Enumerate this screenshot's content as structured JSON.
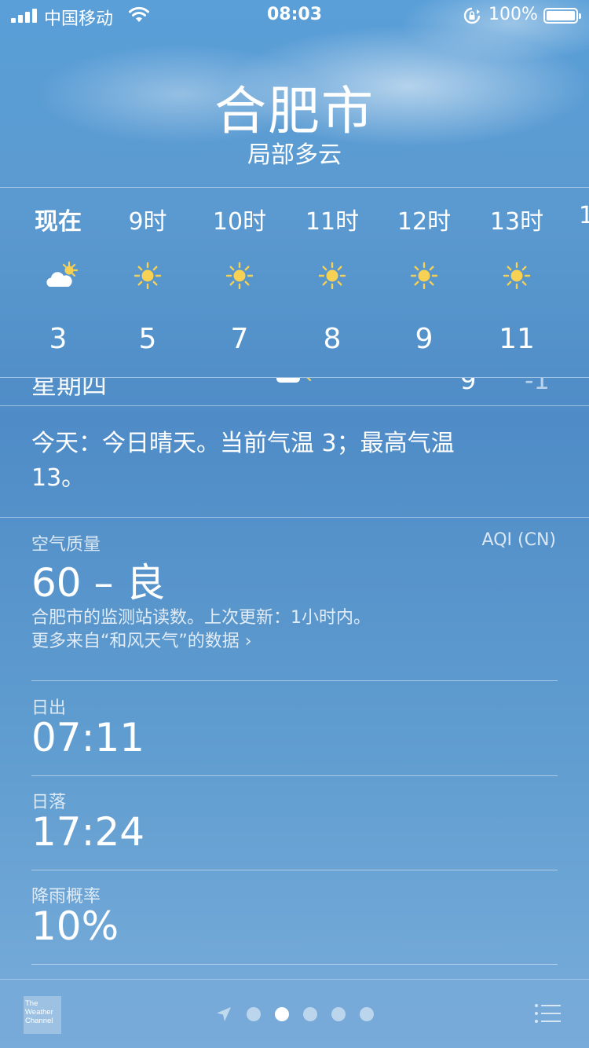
{
  "status_bar": {
    "carrier": "中国移动",
    "time": "08:03",
    "battery": "100%"
  },
  "header": {
    "city": "合肥市",
    "condition": "局部多云"
  },
  "hourly": [
    {
      "label": "现在",
      "icon": "partly-cloudy-icon",
      "temp": "3"
    },
    {
      "label": "9时",
      "icon": "sun-icon",
      "temp": "5"
    },
    {
      "label": "10时",
      "icon": "sun-icon",
      "temp": "7"
    },
    {
      "label": "11时",
      "icon": "sun-icon",
      "temp": "8"
    },
    {
      "label": "12时",
      "icon": "sun-icon",
      "temp": "9"
    },
    {
      "label": "13时",
      "icon": "sun-icon",
      "temp": "11"
    },
    {
      "label": "1"
    }
  ],
  "daily_peek": {
    "day": "星期四",
    "high": "9",
    "low": "-1"
  },
  "summary": "今天：今日晴天。当前气温 3；最高气温 13。",
  "air_quality": {
    "label": "空气质量",
    "scale": "AQI (CN)",
    "value": "60 – 良",
    "note": "合肥市的监测站读数。上次更新：1小时内。",
    "link": "更多来自“和风天气”的数据"
  },
  "details": [
    {
      "label": "日出",
      "value": "07:11"
    },
    {
      "label": "日落",
      "value": "17:24"
    },
    {
      "label": "降雨概率",
      "value": "10%"
    }
  ],
  "bottom_bar": {
    "logo_lines": [
      "The",
      "Weather",
      "Channel"
    ],
    "page_count": 5,
    "active_page": 1
  },
  "colors": {
    "sun": "#f7d154",
    "sky": "#5a9fd8"
  }
}
